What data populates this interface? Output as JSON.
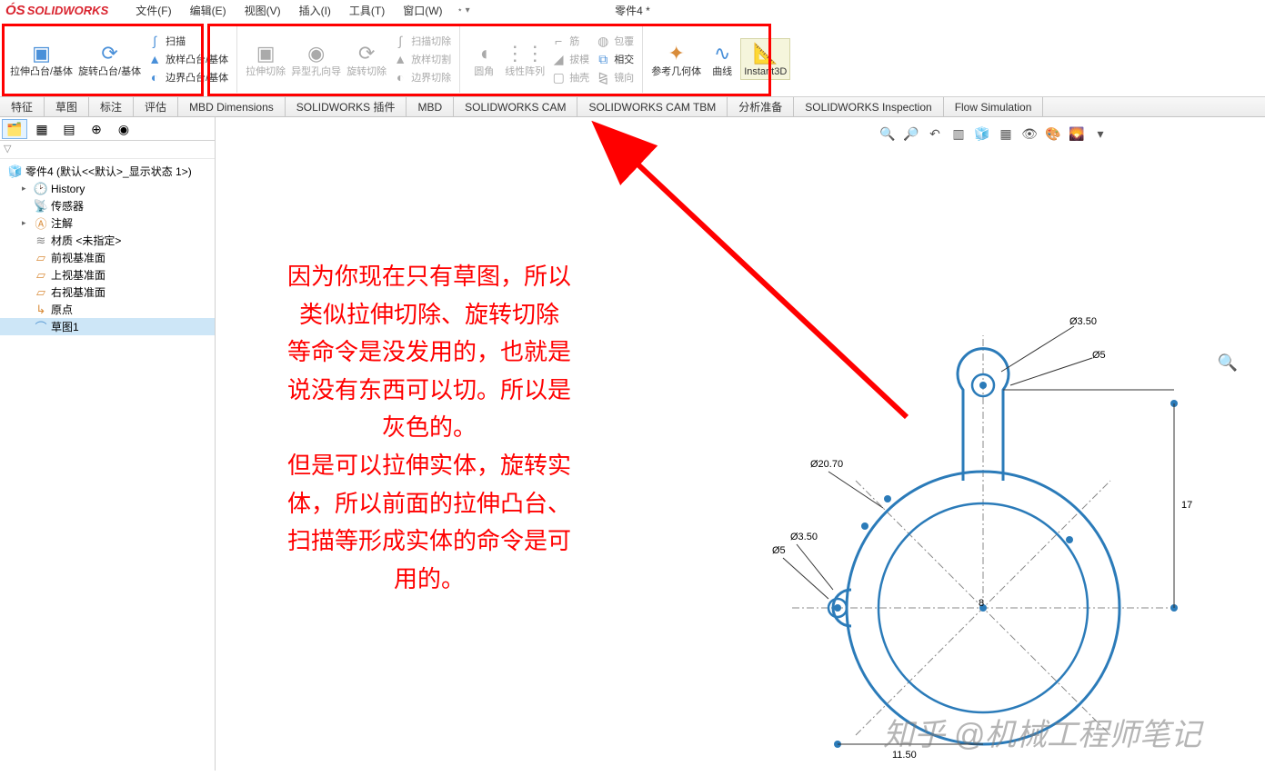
{
  "app": {
    "logo_text": "SOLIDWORKS",
    "doc_title": "零件4 *"
  },
  "menu": {
    "file": "文件(F)",
    "edit": "编辑(E)",
    "view": "视图(V)",
    "insert": "插入(I)",
    "tools": "工具(T)",
    "window": "窗口(W)"
  },
  "ribbon": {
    "extrude": "拉伸凸台/基体",
    "revolve": "旋转凸台/基体",
    "sweep": "扫描",
    "loft": "放样凸台/基体",
    "boundary": "边界凸台/基体",
    "cut_extrude": "拉伸切除",
    "cut_hole": "异型孔向导",
    "cut_revolve": "旋转切除",
    "cut_sweep": "扫描切除",
    "cut_loft": "放样切割",
    "cut_boundary": "边界切除",
    "fillet": "圆角",
    "linear_pattern": "线性阵列",
    "rib": "筋",
    "draft": "拔模",
    "shell": "抽壳",
    "wrap": "包覆",
    "intersect": "相交",
    "mirror": "镜向",
    "ref_geom": "参考几何体",
    "curves": "曲线",
    "instant3d": "Instant3D"
  },
  "tabs": {
    "features": "特征",
    "sketch": "草图",
    "annotate": "标注",
    "evaluate": "评估",
    "mbd": "MBD Dimensions",
    "swaddins": "SOLIDWORKS 插件",
    "mbd2": "MBD",
    "swcam": "SOLIDWORKS CAM",
    "swcamtbm": "SOLIDWORKS CAM TBM",
    "analysis": "分析准备",
    "inspection": "SOLIDWORKS Inspection",
    "flowsim": "Flow Simulation"
  },
  "tree": {
    "root": "零件4 (默认<<默认>_显示状态 1>)",
    "history": "History",
    "sensors": "传感器",
    "annotations": "注解",
    "material": "材质 <未指定>",
    "front": "前视基准面",
    "top": "上视基准面",
    "right": "右视基准面",
    "origin": "原点",
    "sketch1": "草图1"
  },
  "annotation": {
    "l1": "因为你现在只有草图，所以",
    "l2": "类似拉伸切除、旋转切除",
    "l3": "等命令是没发用的，也就是",
    "l4": "说没有东西可以切。所以是",
    "l5": "灰色的。",
    "l6": "但是可以拉伸实体，旋转实",
    "l7": "体，所以前面的拉伸凸台、",
    "l8": "扫描等形成实体的命令是可",
    "l9": "用的。"
  },
  "dims": {
    "d1": "Ø3.50",
    "d2": "Ø5",
    "d3": "Ø20.70",
    "d4": "Ø5",
    "d5": "Ø3.50",
    "d6": "8",
    "d7": "17",
    "d8": "11.50"
  },
  "watermark": "知乎 @机械工程师笔记"
}
